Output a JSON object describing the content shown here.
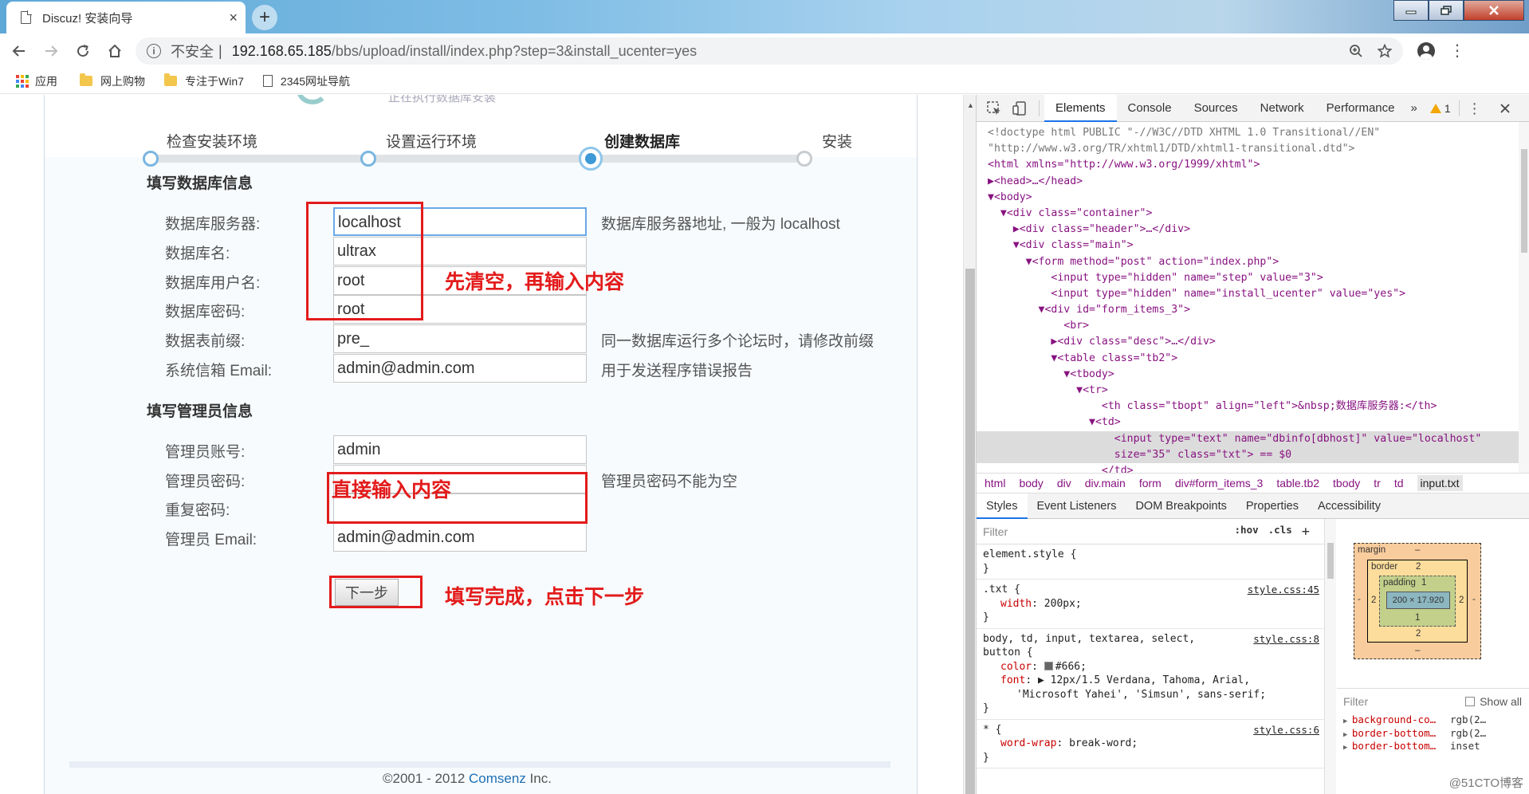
{
  "browser": {
    "tab_title": "Discuz! 安装向导",
    "tab_close": "×",
    "new_tab": "+",
    "security_label": "不安全",
    "url_host": "192.168.65.185",
    "url_path": "/bbs/upload/install/index.php?step=3&install_ucenter=yes",
    "bookmarks": [
      {
        "label": "应用",
        "icon": "apps-icon"
      },
      {
        "label": "网上购物",
        "icon": "folder-icon"
      },
      {
        "label": "专注于Win7",
        "icon": "folder-icon"
      },
      {
        "label": "2345网址导航",
        "icon": "page-icon"
      }
    ]
  },
  "page": {
    "steps": [
      {
        "label": "检查安装环境",
        "state": "done"
      },
      {
        "label": "设置运行环境",
        "state": "done"
      },
      {
        "label": "创建数据库",
        "state": "current"
      },
      {
        "label": "安装",
        "state": "pending"
      }
    ],
    "db_section_title": "填写数据库信息",
    "db_fields": [
      {
        "label": "数据库服务器:",
        "value": "localhost",
        "hint": "数据库服务器地址, 一般为 localhost"
      },
      {
        "label": "数据库名:",
        "value": "ultrax",
        "hint": ""
      },
      {
        "label": "数据库用户名:",
        "value": "root",
        "hint": ""
      },
      {
        "label": "数据库密码:",
        "value": "root",
        "hint": ""
      },
      {
        "label": "数据表前缀:",
        "value": "pre_",
        "hint": "同一数据库运行多个论坛时，请修改前缀"
      },
      {
        "label": "系统信箱 Email:",
        "value": "admin@admin.com",
        "hint": "用于发送程序错误报告"
      }
    ],
    "admin_section_title": "填写管理员信息",
    "admin_fields": [
      {
        "label": "管理员账号:",
        "value": "admin",
        "hint": ""
      },
      {
        "label": "管理员密码:",
        "value": "",
        "hint": "管理员密码不能为空"
      },
      {
        "label": "重复密码:",
        "value": "",
        "hint": ""
      },
      {
        "label": "管理员 Email:",
        "value": "admin@admin.com",
        "hint": ""
      }
    ],
    "next_button": "下一步",
    "footer_prefix": "©2001 - 2012 ",
    "footer_brand": "Comsenz",
    "footer_suffix": " Inc."
  },
  "annotations": {
    "clear_then_type": "先清空，再输入内容",
    "type_directly": "直接输入内容",
    "click_next": "填写完成，点击下一步",
    "accent_color": "#e31b1b"
  },
  "devtools": {
    "tabs": [
      "Elements",
      "Console",
      "Sources",
      "Network",
      "Performance"
    ],
    "more": "»",
    "warning_count": "1",
    "dom_lines": [
      {
        "t": "<!doctype html PUBLIC \"-//W3C//DTD XHTML 1.0 Transitional//EN\"",
        "k": "cm"
      },
      {
        "t": "\"http://www.w3.org/TR/xhtml1/DTD/xhtml1-transitional.dtd\">",
        "k": "cm"
      },
      {
        "t": "<html xmlns=\"http://www.w3.org/1999/xhtml\">",
        "k": "tag"
      },
      {
        "t": "▶<head>…</head>",
        "k": "tag"
      },
      {
        "t": "▼<body>",
        "k": "tag"
      },
      {
        "t": "  ▼<div class=\"container\">",
        "k": "tag"
      },
      {
        "t": "    ▶<div class=\"header\">…</div>",
        "k": "tag"
      },
      {
        "t": "    ▼<div class=\"main\">",
        "k": "tag"
      },
      {
        "t": "      ▼<form method=\"post\" action=\"index.php\">",
        "k": "tag"
      },
      {
        "t": "          <input type=\"hidden\" name=\"step\" value=\"3\">",
        "k": "tag"
      },
      {
        "t": "          <input type=\"hidden\" name=\"install_ucenter\" value=\"yes\">",
        "k": "tag"
      },
      {
        "t": "        ▼<div id=\"form_items_3\">",
        "k": "tag"
      },
      {
        "t": "            <br>",
        "k": "tag"
      },
      {
        "t": "          ▶<div class=\"desc\">…</div>",
        "k": "tag"
      },
      {
        "t": "          ▼<table class=\"tb2\">",
        "k": "tag"
      },
      {
        "t": "            ▼<tbody>",
        "k": "tag"
      },
      {
        "t": "              ▼<tr>",
        "k": "tag"
      },
      {
        "t": "                  <th class=\"tbopt\" align=\"left\">&nbsp;数据库服务器:</th>",
        "k": "tag"
      },
      {
        "t": "                ▼<td>",
        "k": "tag"
      },
      {
        "t": "                    <input type=\"text\" name=\"dbinfo[dbhost]\" value=\"localhost\"",
        "k": "sel"
      },
      {
        "t": "                    size=\"35\" class=\"txt\"> == $0",
        "k": "sel"
      },
      {
        "t": "                  </td>",
        "k": "tag"
      }
    ],
    "breadcrumbs": [
      "html",
      "body",
      "div",
      "div.main",
      "form",
      "div#form_items_3",
      "table.tb2",
      "tbody",
      "tr",
      "td",
      "input.txt"
    ],
    "sub_tabs": [
      "Styles",
      "Event Listeners",
      "DOM Breakpoints",
      "Properties",
      "Accessibility"
    ],
    "filter_placeholder": "Filter",
    "hov": ":hov",
    "cls": ".cls",
    "rules": [
      {
        "selector": "element.style {",
        "source": "",
        "props": [],
        "close": "}"
      },
      {
        "selector": ".txt {",
        "source": "style.css:45",
        "props": [
          {
            "n": "width",
            "v": "200px;"
          }
        ],
        "close": "}"
      },
      {
        "selector": "body, td, input, textarea, select,",
        "selector2": "button {",
        "source": "style.css:8",
        "props": [
          {
            "n": "color",
            "v": "#666;",
            "swatch": "#666666"
          },
          {
            "n": "font",
            "v": "▶ 12px/1.5 Verdana, Tahoma, Arial,"
          }
        ],
        "extra": "'Microsoft Yahei', 'Simsun', sans-serif;",
        "close": "}"
      },
      {
        "selector": "* {",
        "source": "style.css:6",
        "props": [
          {
            "n": "word-wrap",
            "v": "break-word;"
          }
        ],
        "close": "}"
      }
    ],
    "box_model": {
      "margin_label": "margin",
      "margin_top": "–",
      "margin_bottom": "–",
      "border_label": "border",
      "border_value": "2",
      "padding_label": "padding",
      "padding_value": "1",
      "content": "200 × 17.920",
      "side_dash": "-"
    },
    "computed_filter": "Filter",
    "show_all": "Show all",
    "computed": [
      {
        "n": "background-co…",
        "v": "rgb(2…"
      },
      {
        "n": "border-bottom…",
        "v": "rgb(2…"
      },
      {
        "n": "border-bottom…",
        "v": "inset"
      }
    ],
    "watermark": "@51CTO博客"
  }
}
